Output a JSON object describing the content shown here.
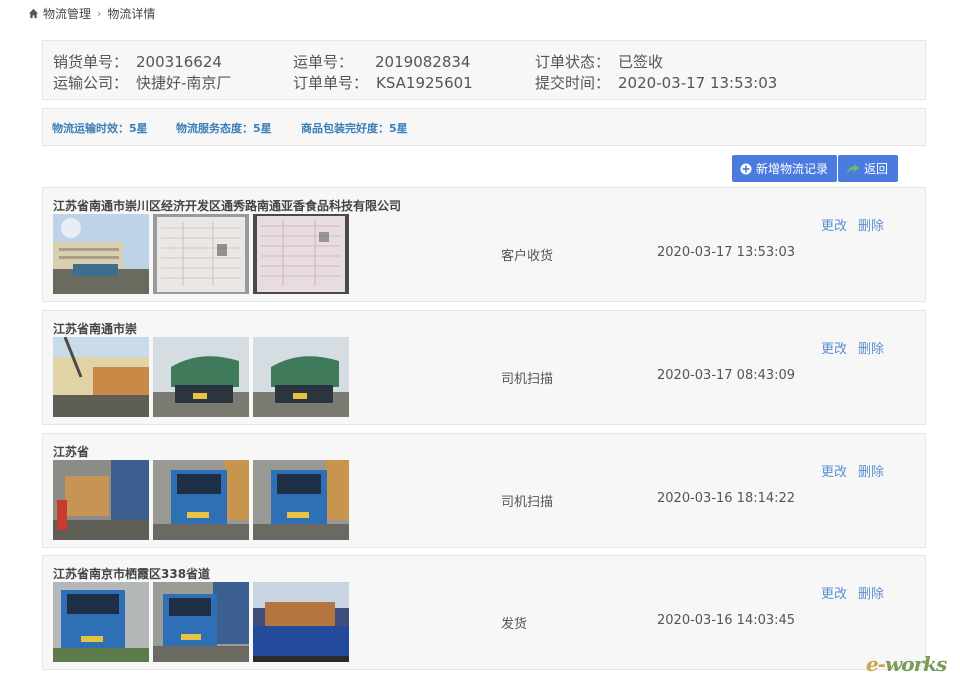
{
  "breadcrumb": {
    "home_icon": "home-icon",
    "level1": "物流管理",
    "level2": "物流详情"
  },
  "order": {
    "sales_no_label": "销货单号：",
    "sales_no": "200316624",
    "waybill_label": "运单号：",
    "waybill": "2019082834",
    "status_label": "订单状态：",
    "status": "已签收",
    "carrier_label": "运输公司：",
    "carrier": "快捷好-南京厂",
    "order_no_label": "订单单号：",
    "order_no": "KSA1925601",
    "submit_label": "提交时间：",
    "submit_time": "2020-03-17 13:53:03"
  },
  "ratings": [
    "物流运输时效：5星",
    "物流服务态度：5星",
    "商品包装完好度：5星"
  ],
  "toolbar": {
    "add_label": "新增物流记录",
    "back_label": "返回"
  },
  "records": [
    {
      "address": "江苏省南通市崇川区经济开发区通秀路南通亚香食品科技有限公司",
      "action": "客户收货",
      "time": "2020-03-17 13:53:03",
      "edit": "更改",
      "delete": "删除"
    },
    {
      "address": "江苏省南通市崇",
      "action": "司机扫描",
      "time": "2020-03-17 08:43:09",
      "edit": "更改",
      "delete": "删除"
    },
    {
      "address": "江苏省",
      "action": "司机扫描",
      "time": "2020-03-16 18:14:22",
      "edit": "更改",
      "delete": "删除"
    },
    {
      "address": "江苏省南京市栖霞区338省道",
      "action": "发货",
      "time": "2020-03-16 14:03:45",
      "edit": "更改",
      "delete": "删除"
    }
  ],
  "watermark": {
    "part1": "e-",
    "part2": "works"
  }
}
